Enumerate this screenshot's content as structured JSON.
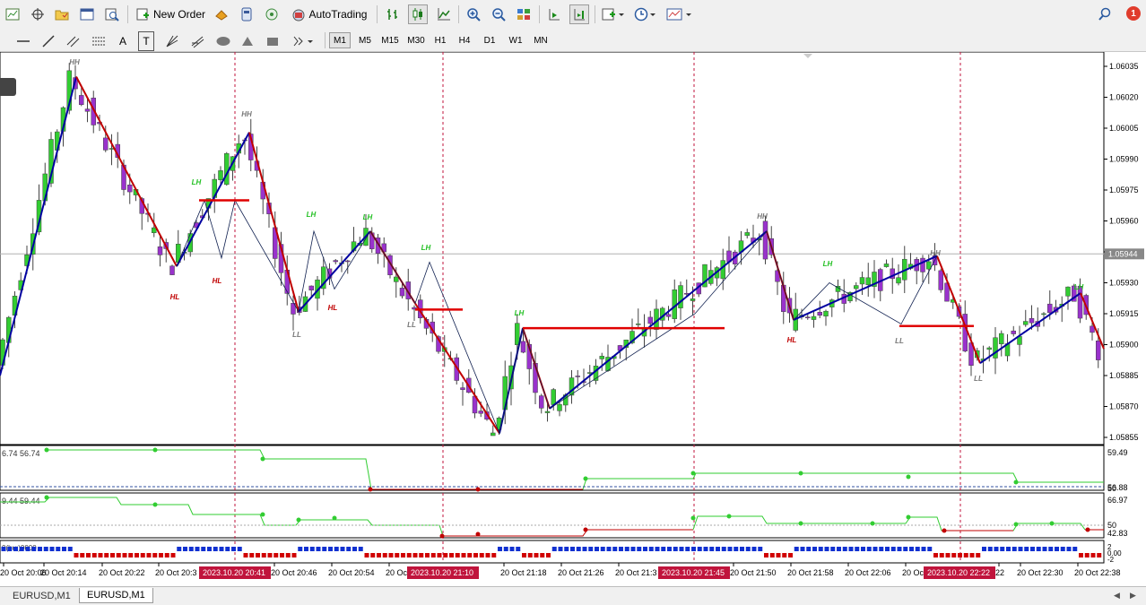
{
  "toolbar": {
    "new_order_label": "New Order",
    "autotrading_label": "AutoTrading",
    "notification_count": "1"
  },
  "timeframes": [
    "M1",
    "M5",
    "M15",
    "M30",
    "H1",
    "H4",
    "D1",
    "W1",
    "MN"
  ],
  "active_timeframe": "M1",
  "draw_tool_letters": {
    "text": "A",
    "label": "T"
  },
  "chart": {
    "current_price": "1.05944",
    "price_ticks": [
      "1.06035",
      "1.06020",
      "1.06005",
      "1.05990",
      "1.05975",
      "1.05960",
      "1.05945",
      "1.05930",
      "1.05915",
      "1.05900",
      "1.05885",
      "1.05870",
      "1.05855"
    ],
    "time_ticks": [
      "20 Oct 20:06",
      "20 Oct 20:14",
      "20 Oct 20:22",
      "20 Oct 20:3",
      "20 Oct 20:46",
      "20 Oct 20:54",
      "20 Oct 2",
      "20 Oct 21:18",
      "20 Oct 21:26",
      "20 Oct 21:3",
      "20 Oct 21:50",
      "20 Oct 21:58",
      "20 Oct 22:06",
      "20 Oct 2",
      "22",
      "20 Oct 22:30",
      "20 Oct 22:38"
    ],
    "time_markers": [
      "2023.10.20 20:41",
      "2023.10.20 21:10",
      "2023.10.20 21:45",
      "2023.10.20 22:22"
    ],
    "swing_labels": [
      "HH",
      "HH",
      "LH",
      "HL",
      "HL",
      "LL",
      "LH",
      "LH",
      "HL",
      "LL",
      "LH",
      "LH",
      "HH",
      "LH",
      "HL",
      "LL",
      "HH",
      "LL",
      "LH"
    ],
    "indicator1": {
      "caption": "6.74 56.74",
      "levels": [
        "59.49",
        "56.88",
        "50"
      ]
    },
    "indicator2": {
      "caption": "9.44 59.44",
      "levels": [
        "66.97",
        "50",
        "42.83"
      ]
    },
    "indicator3": {
      "caption": "0(bu:)0000",
      "levels": [
        "2",
        "0.00",
        "-2"
      ]
    },
    "colors": {
      "up": "#32cd32",
      "down": "#9932cc",
      "zigzag_up": "#0000a0",
      "zigzag_down": "#c00000",
      "level_line": "#e00000",
      "marker": "#c0143c"
    }
  },
  "tabs": [
    "EURUSD,M1",
    "EURUSD,M1"
  ],
  "active_tab": 1
}
